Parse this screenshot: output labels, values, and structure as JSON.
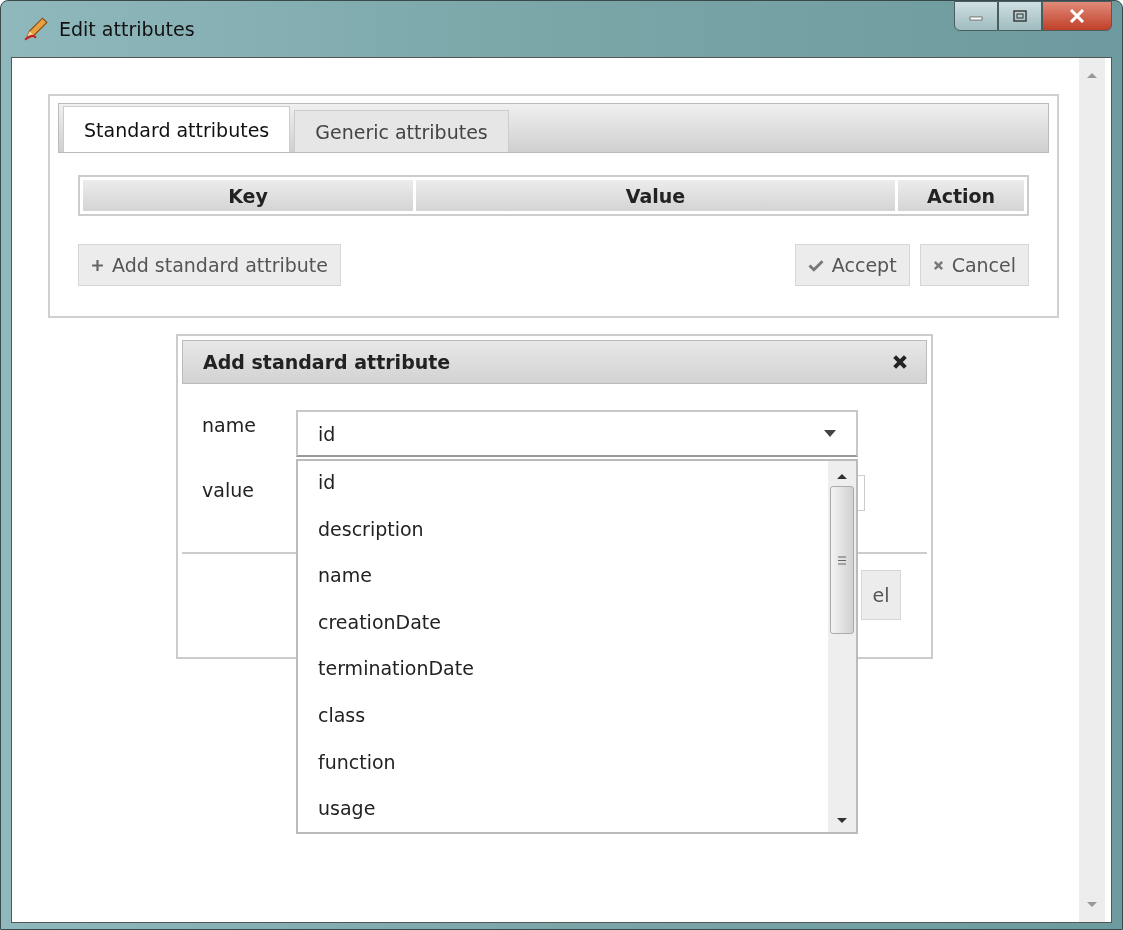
{
  "window": {
    "title": "Edit attributes"
  },
  "tabs": [
    {
      "label": "Standard attributes",
      "selected": true
    },
    {
      "label": "Generic attributes",
      "selected": false
    }
  ],
  "table": {
    "columns": [
      "Key",
      "Value",
      "Action"
    ]
  },
  "buttons": [
    {
      "label": "Add standard attribute",
      "kind": "add"
    },
    {
      "label": "Accept",
      "kind": "accept"
    },
    {
      "label": "Cancel",
      "kind": "cancel"
    }
  ],
  "dialog": {
    "title": "Add standard attribute",
    "fields": [
      {
        "label": "name",
        "value": "id"
      },
      {
        "label": "value"
      }
    ],
    "footer_button": "el"
  },
  "dropdown": {
    "options": [
      "id",
      "description",
      "name",
      "creationDate",
      "terminationDate",
      "class",
      "function",
      "usage"
    ]
  }
}
